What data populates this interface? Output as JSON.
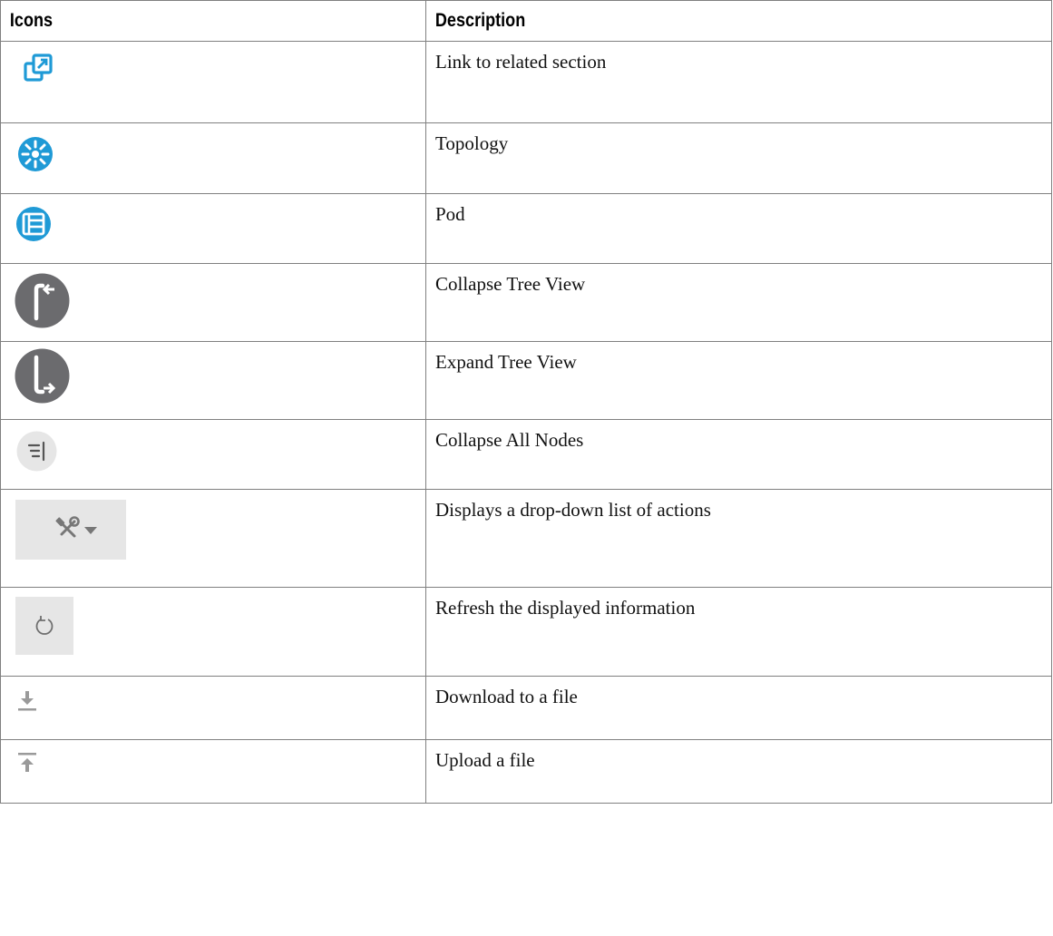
{
  "table": {
    "headers": {
      "icons": "Icons",
      "description": "Description"
    },
    "rows": [
      {
        "icon": "link-to-related-section-icon",
        "description": "Link to related section"
      },
      {
        "icon": "topology-icon",
        "description": "Topology"
      },
      {
        "icon": "pod-icon",
        "description": "Pod"
      },
      {
        "icon": "collapse-tree-view-icon",
        "description": "Collapse Tree View"
      },
      {
        "icon": "expand-tree-view-icon",
        "description": "Expand Tree View"
      },
      {
        "icon": "collapse-all-nodes-icon",
        "description": "Collapse All Nodes"
      },
      {
        "icon": "actions-dropdown-icon",
        "description": "Displays a drop-down list of actions"
      },
      {
        "icon": "refresh-icon",
        "description": "Refresh the displayed information"
      },
      {
        "icon": "download-icon",
        "description": "Download to a file"
      },
      {
        "icon": "upload-icon",
        "description": "Upload a file"
      }
    ]
  },
  "colors": {
    "accent_blue": "#1f9ad6",
    "icon_dark_gray": "#6b6b6e",
    "icon_light_gray": "#e6e6e6",
    "border": "#808080"
  }
}
